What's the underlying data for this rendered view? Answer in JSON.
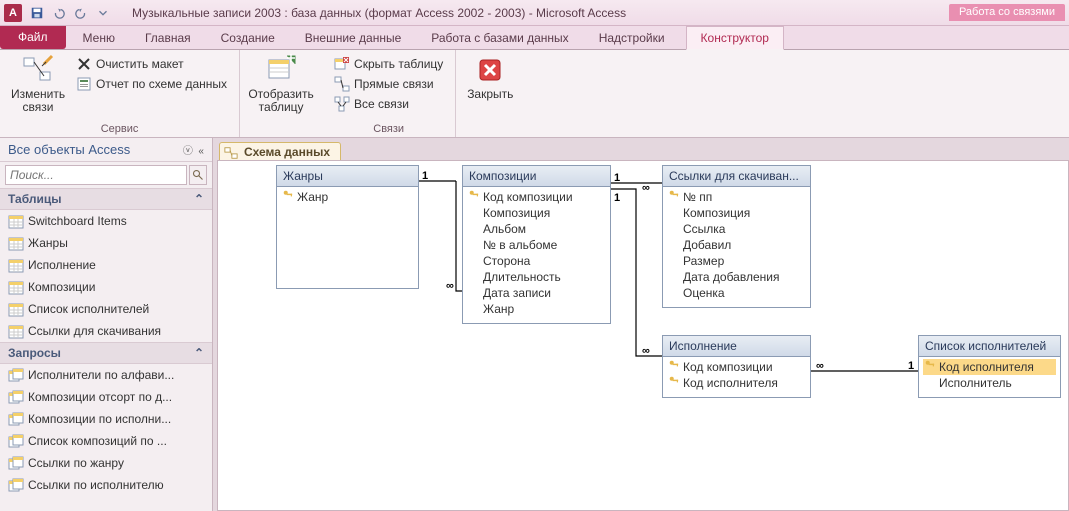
{
  "title": "Музыкальные записи 2003 : база данных (формат Access 2002 - 2003)  -  Microsoft Access",
  "context_tab_group": "Работа со связями",
  "tabs": {
    "file": "Файл",
    "items": [
      "Меню",
      "Главная",
      "Создание",
      "Внешние данные",
      "Работа с базами данных",
      "Надстройки"
    ],
    "context": "Конструктор"
  },
  "ribbon": {
    "group1": {
      "edit_relations": "Изменить связи",
      "clear_layout": "Очистить макет",
      "report": "Отчет по схеме данных",
      "label": "Сервис"
    },
    "group2": {
      "show_table": "Отобразить таблицу"
    },
    "group3": {
      "hide_table": "Скрыть таблицу",
      "direct": "Прямые связи",
      "all": "Все связи",
      "label": "Связи"
    },
    "group4": {
      "close": "Закрыть"
    }
  },
  "nav": {
    "header": "Все объекты Access",
    "search_ph": "Поиск...",
    "sections": {
      "tables": {
        "label": "Таблицы",
        "items": [
          "Switchboard Items",
          "Жанры",
          "Исполнение",
          "Композиции",
          "Список исполнителей",
          "Ссылки для скачивания"
        ]
      },
      "queries": {
        "label": "Запросы",
        "items": [
          "Исполнители по алфави...",
          "Композиции отсорт по д...",
          "Композиции по исполни...",
          "Список композиций  по ...",
          "Ссылки по жанру",
          "Ссылки по исполнителю"
        ]
      }
    }
  },
  "doc_tab": "Схема данных",
  "tables": {
    "zhanry": {
      "title": "Жанры",
      "fields": [
        {
          "n": "Жанр",
          "k": true
        }
      ]
    },
    "kompozicii": {
      "title": "Композиции",
      "fields": [
        {
          "n": "Код композиции",
          "k": true
        },
        {
          "n": "Композиция"
        },
        {
          "n": "Альбом"
        },
        {
          "n": "№ в альбоме"
        },
        {
          "n": "Сторона"
        },
        {
          "n": "Длительность"
        },
        {
          "n": "Дата записи"
        },
        {
          "n": "Жанр"
        }
      ]
    },
    "ssylki": {
      "title": "Ссылки для скачиван...",
      "fields": [
        {
          "n": "№ пп",
          "k": true
        },
        {
          "n": "Композиция"
        },
        {
          "n": "Ссылка"
        },
        {
          "n": "Добавил"
        },
        {
          "n": "Размер"
        },
        {
          "n": "Дата добавления"
        },
        {
          "n": "Оценка"
        }
      ]
    },
    "ispolnenie": {
      "title": "Исполнение",
      "fields": [
        {
          "n": "Код композиции",
          "k": true
        },
        {
          "n": "Код исполнителя",
          "k": true
        }
      ]
    },
    "spisok": {
      "title": "Список исполнителей",
      "fields": [
        {
          "n": "Код исполнителя",
          "k": true,
          "sel": true
        },
        {
          "n": "Исполнитель"
        }
      ]
    }
  },
  "rels": {
    "one": "1",
    "many": "∞"
  }
}
